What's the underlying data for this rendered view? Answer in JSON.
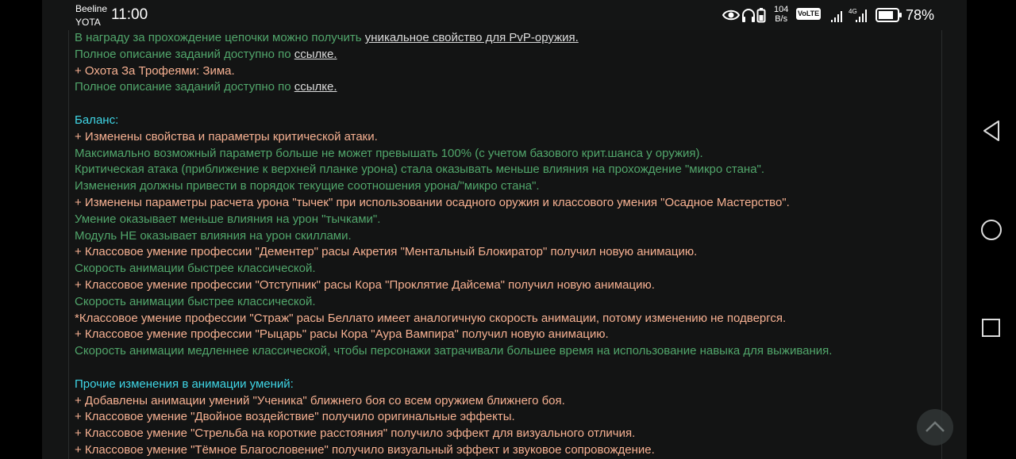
{
  "status_bar": {
    "carrier_1": "Beeline",
    "carrier_2": "YOTA",
    "time": "11:00",
    "net_speed_value": "104",
    "net_speed_unit": "B/s",
    "volte": "VoLTE",
    "battery": "78%"
  },
  "nav": {
    "back_icon": "triangle-back-icon",
    "home_icon": "circle-home-icon",
    "recents_icon": "square-recents-icon"
  },
  "content": {
    "lines": [
      {
        "type": "mixed",
        "color": "green",
        "text": "В награду за прохождение цепочки можно получить ",
        "link": "уникальное свойство для PvP-оружия."
      },
      {
        "type": "mixed",
        "color": "green",
        "text": "Полное описание заданий доступно по ",
        "link": "ссылке."
      },
      {
        "type": "text",
        "color": "orange",
        "text": "+ Охота За Трофеями: Зима."
      },
      {
        "type": "mixed",
        "color": "green",
        "text": "Полное описание заданий доступно по ",
        "link": "ссылке."
      },
      {
        "type": "blank",
        "text": ""
      },
      {
        "type": "text",
        "color": "cyan",
        "text": "Баланс:"
      },
      {
        "type": "text",
        "color": "orange",
        "text": "+ Изменены свойства и параметры критической атаки."
      },
      {
        "type": "text",
        "color": "green",
        "text": "Максимально возможный параметр больше не может превышать 100% (с учетом базового крит.шанса у оружия)."
      },
      {
        "type": "text",
        "color": "green",
        "text": "Критическая атака (приближение к верхней планке урона) стала оказывать меньше влияния на прохождение \"микро стана\"."
      },
      {
        "type": "text",
        "color": "green",
        "text": "Изменения должны привести в порядок текущие соотношения урона/\"микро стана\"."
      },
      {
        "type": "text",
        "color": "orange",
        "text": "+ Изменены параметры расчета урона \"тычек\" при использовании осадного оружия и классового умения \"Осадное Мастерство\"."
      },
      {
        "type": "text",
        "color": "green",
        "text": "Умение оказывает меньше влияния на урон \"тычками\"."
      },
      {
        "type": "text",
        "color": "green",
        "text": "Модуль НЕ оказывает влияния на урон скиллами."
      },
      {
        "type": "text",
        "color": "orange",
        "text": "+ Классовое умение профессии \"Дементер\" расы Акретия \"Ментальный Блокиратор\" получил новую анимацию."
      },
      {
        "type": "text",
        "color": "green",
        "text": "Скорость анимации быстрее классической."
      },
      {
        "type": "text",
        "color": "orange",
        "text": "+ Классовое умение профессии \"Отступник\" расы Кора \"Проклятие Дайсема\" получил новую анимацию."
      },
      {
        "type": "text",
        "color": "green",
        "text": "Скорость анимации быстрее классической."
      },
      {
        "type": "text",
        "color": "orange",
        "text": "*Классовое умение профессии \"Страж\" расы Беллато имеет аналогичную скорость анимации, потому изменению не подвергся."
      },
      {
        "type": "text",
        "color": "orange",
        "text": "+ Классовое умение профессии \"Рыцарь\" расы Кора \"Аура Вампира\" получил новую анимацию."
      },
      {
        "type": "text",
        "color": "green",
        "text": "Скорость анимации медленнее классической, чтобы персонажи затрачивали большее время на использование навыка для выживания."
      },
      {
        "type": "blank",
        "text": ""
      },
      {
        "type": "text",
        "color": "cyan",
        "text": "Прочие изменения в анимации умений:"
      },
      {
        "type": "text",
        "color": "orange",
        "text": "+ Добавлены анимации умений \"Ученика\" ближнего боя со всем оружием ближнего боя."
      },
      {
        "type": "text",
        "color": "orange",
        "text": "+ Классовое умение \"Двойное воздействие\" получило оригинальные эффекты."
      },
      {
        "type": "text",
        "color": "orange",
        "text": "+ Классовое умение \"Стрельба на короткие расстояния\" получило эффект для визуального отличия."
      },
      {
        "type": "text",
        "color": "orange",
        "text": "+ Классовое умение \"Тёмное Благословение\" получило визуальный эффект и звуковое сопровождение."
      }
    ]
  },
  "scroll_top_icon": "chevron-up-icon"
}
